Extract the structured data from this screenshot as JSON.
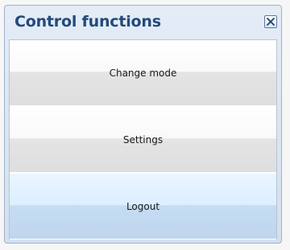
{
  "dialog": {
    "title": "Control functions",
    "close_icon": "close-icon"
  },
  "menu": {
    "items": [
      {
        "label": "Change mode",
        "state": "normal"
      },
      {
        "label": "Settings",
        "state": "normal"
      },
      {
        "label": "Logout",
        "state": "highlighted"
      }
    ]
  },
  "colors": {
    "title_text": "#234a7a",
    "highlight": "#dcefff",
    "frame": "#d3e0ef"
  }
}
